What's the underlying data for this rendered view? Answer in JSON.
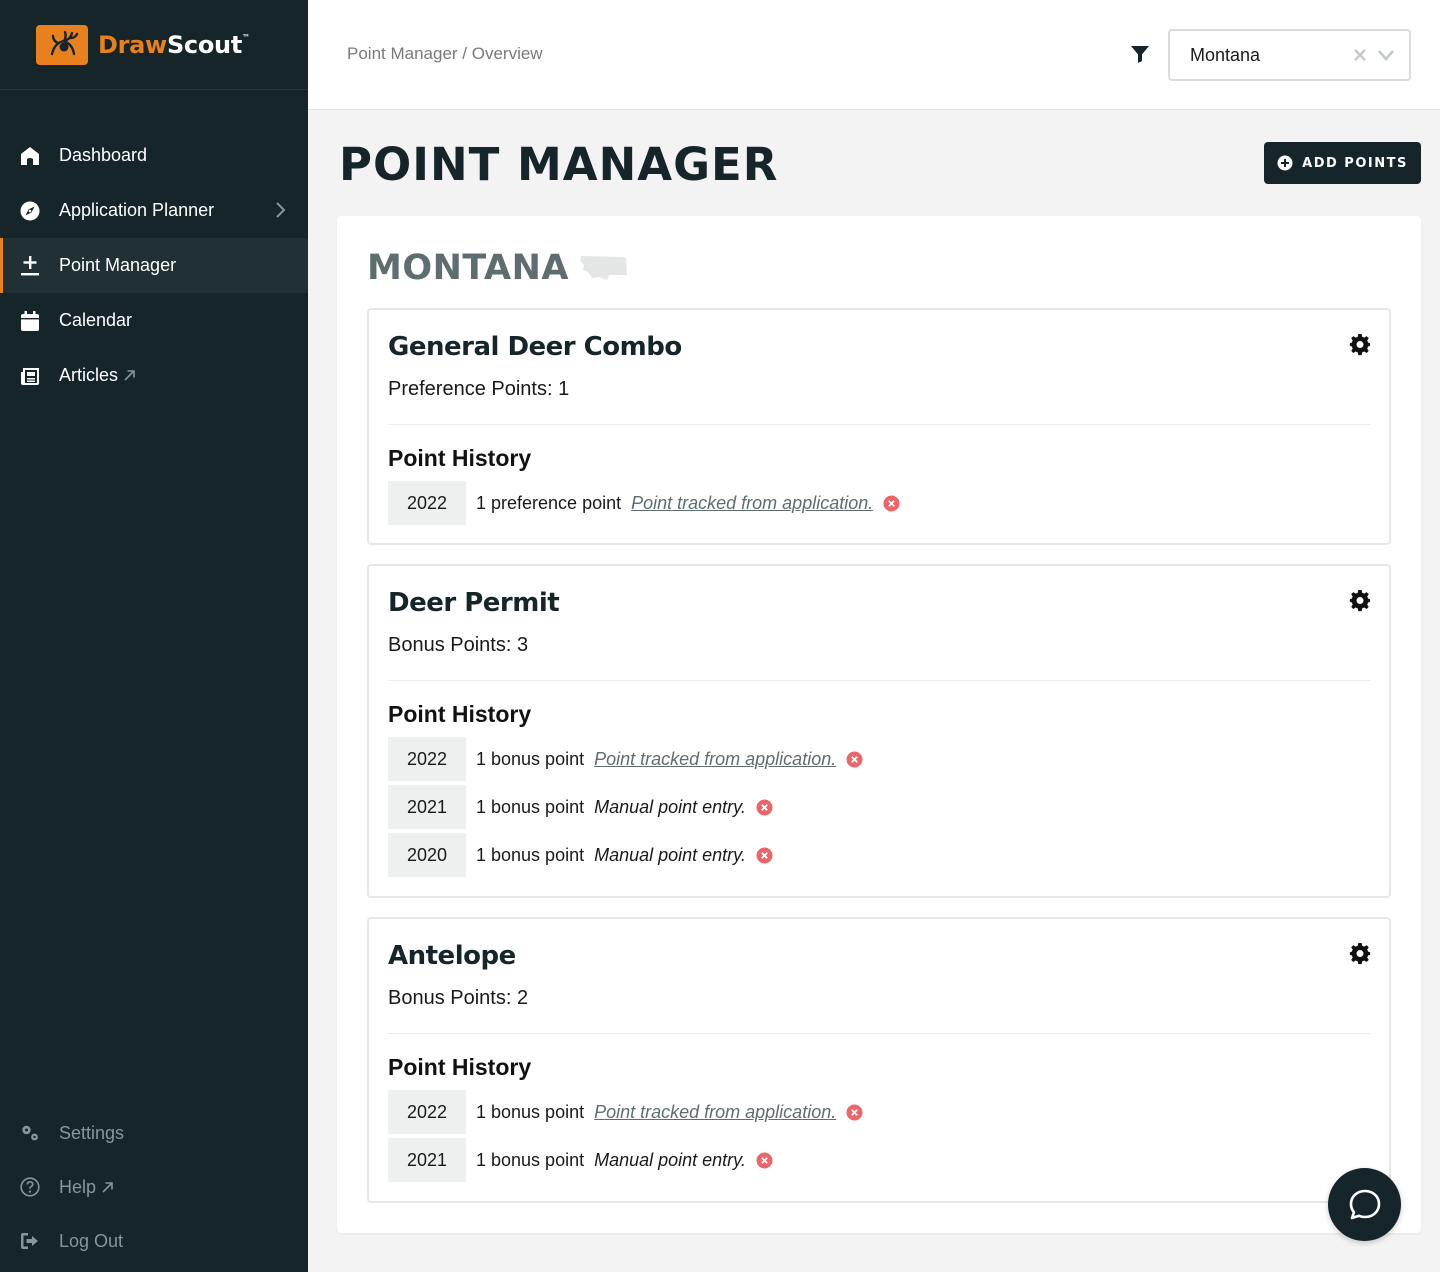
{
  "brand": {
    "draw": "Draw",
    "scout": "Scout",
    "tm": "™",
    "accent": "#e8801e",
    "dark": "#16252a"
  },
  "nav": {
    "items": [
      {
        "label": "Dashboard",
        "icon": "home-icon"
      },
      {
        "label": "Application Planner",
        "icon": "compass-icon"
      },
      {
        "label": "Point Manager",
        "icon": "plus-minus-icon",
        "active": true
      },
      {
        "label": "Calendar",
        "icon": "calendar-icon"
      },
      {
        "label": "Articles",
        "icon": "newspaper-icon"
      }
    ],
    "bottom": [
      {
        "label": "Settings",
        "icon": "gears-icon"
      },
      {
        "label": "Help",
        "icon": "help-icon"
      },
      {
        "label": "Log Out",
        "icon": "logout-icon"
      }
    ]
  },
  "topbar": {
    "breadcrumb": "Point Manager / Overview",
    "state_select": {
      "value": "Montana"
    }
  },
  "header": {
    "title": "POINT MANAGER",
    "add_button": "ADD POINTS"
  },
  "state": {
    "name": "MONTANA"
  },
  "species": [
    {
      "name": "General Deer Combo",
      "points_label": "Preference Points: 1",
      "history_title": "Point History",
      "history": [
        {
          "year": "2022",
          "desc": "1 preference point",
          "note": "Point tracked from application.",
          "link": true
        }
      ]
    },
    {
      "name": "Deer Permit",
      "points_label": "Bonus Points: 3",
      "history_title": "Point History",
      "history": [
        {
          "year": "2022",
          "desc": "1 bonus point",
          "note": "Point tracked from application.",
          "link": true
        },
        {
          "year": "2021",
          "desc": "1 bonus point",
          "note": "Manual point entry.",
          "link": false
        },
        {
          "year": "2020",
          "desc": "1 bonus point",
          "note": "Manual point entry.",
          "link": false
        }
      ]
    },
    {
      "name": "Antelope",
      "points_label": "Bonus Points: 2",
      "history_title": "Point History",
      "history": [
        {
          "year": "2022",
          "desc": "1 bonus point",
          "note": "Point tracked from application.",
          "link": true
        },
        {
          "year": "2021",
          "desc": "1 bonus point",
          "note": "Manual point entry.",
          "link": false
        }
      ]
    }
  ]
}
